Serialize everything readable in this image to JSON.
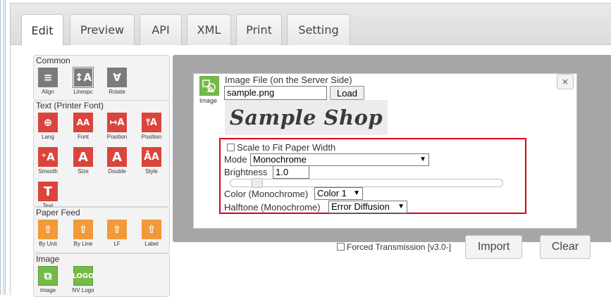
{
  "tabs": [
    {
      "label": "Edit",
      "active": true
    },
    {
      "label": "Preview"
    },
    {
      "label": "API"
    },
    {
      "label": "XML"
    },
    {
      "label": "Print"
    },
    {
      "label": "Setting"
    }
  ],
  "palette": {
    "common": {
      "title": "Common",
      "buttons": [
        {
          "label": "Align",
          "icon": "align-icon"
        },
        {
          "label": "Linespc",
          "icon": "line-spacing-icon"
        },
        {
          "label": "Rotate",
          "icon": "rotate-icon"
        }
      ]
    },
    "text": {
      "title": "Text (Printer Font)",
      "buttons": [
        {
          "label": "Lang",
          "icon": "globe-icon"
        },
        {
          "label": "Font",
          "icon": "font-icon"
        },
        {
          "label": "Position",
          "icon": "text-position-icon"
        },
        {
          "label": "Position",
          "icon": "text-vertical-position-icon"
        },
        {
          "label": "Smooth",
          "icon": "smooth-icon"
        },
        {
          "label": "Size",
          "icon": "size-icon"
        },
        {
          "label": "Double",
          "icon": "double-icon"
        },
        {
          "label": "Style",
          "icon": "style-icon"
        },
        {
          "label": "Text",
          "icon": "text-icon"
        }
      ]
    },
    "paper_feed": {
      "title": "Paper Feed",
      "buttons": [
        {
          "label": "By Unit",
          "icon": "feed-unit-icon"
        },
        {
          "label": "By Line",
          "icon": "feed-line-icon"
        },
        {
          "label": "LF",
          "icon": "line-feed-icon"
        },
        {
          "label": "Label",
          "icon": "label-feed-icon"
        }
      ]
    },
    "image": {
      "title": "Image",
      "buttons": [
        {
          "label": "Image",
          "icon": "image-icon"
        },
        {
          "label": "NV Logo",
          "icon": "nv-logo-icon",
          "glyph": "LOGO"
        }
      ]
    }
  },
  "dialog": {
    "icon_caption": "Image",
    "file_label": "Image File (on the Server Side)",
    "file_value": "sample.png",
    "load_label": "Load",
    "preview_text": "Sample Shop",
    "close_glyph": "×",
    "scale_label": "Scale to Fit Paper Width",
    "scale_checked": false,
    "mode_label": "Mode",
    "mode_value": "Monochrome",
    "brightness_label": "Brightness",
    "brightness_value": "1.0",
    "brightness_slider_fraction": 0.08,
    "color_label": "Color (Monochrome)",
    "color_value": "Color 1",
    "halftone_label": "Halftone (Monochrome)",
    "halftone_value": "Error Diffusion"
  },
  "footer": {
    "forced_label": "Forced Transmission [v3.0-]",
    "forced_checked": false,
    "import_label": "Import",
    "clear_label": "Clear"
  },
  "colors": {
    "highlight": "#d9001b",
    "text_icon": "#d9453c",
    "feed_icon": "#f09a3a",
    "image_icon": "#75b94a",
    "common_icon": "#7b7b7b"
  }
}
